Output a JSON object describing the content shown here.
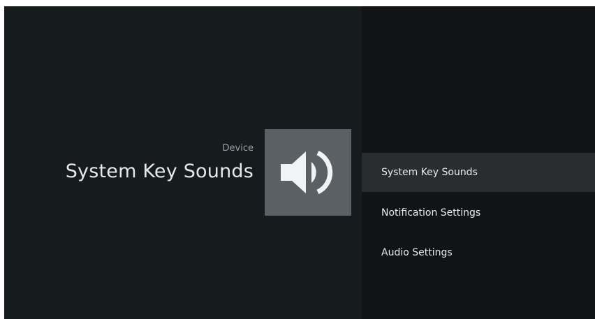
{
  "header": {
    "breadcrumb": "Device",
    "title": "System Key Sounds",
    "icon": "speaker-volume-icon"
  },
  "menu": {
    "items": [
      {
        "label": "System Key Sounds",
        "selected": true
      },
      {
        "label": "Notification Settings",
        "selected": false
      },
      {
        "label": "Audio Settings",
        "selected": false
      }
    ]
  },
  "colors": {
    "background_left": "#161b1e",
    "background_right": "#121314",
    "icon_tile": "#5a6063",
    "selected_item": "#2a2d2f",
    "text": "#e6e8e9"
  }
}
